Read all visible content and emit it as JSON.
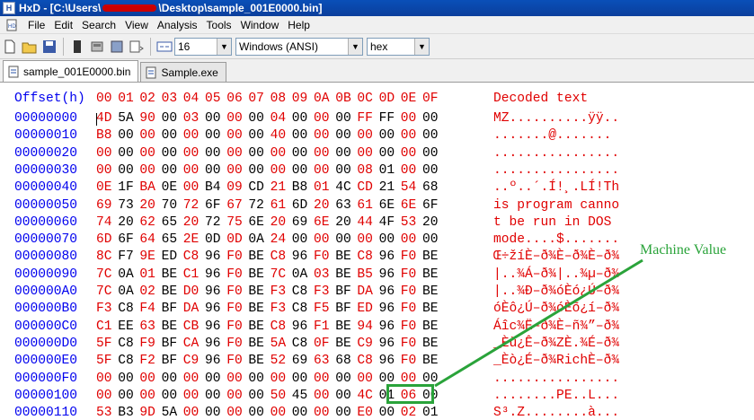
{
  "window": {
    "title_prefix": "HxD - [C:\\Users\\",
    "title_suffix": "\\Desktop\\sample_001E0000.bin]"
  },
  "menu": [
    "File",
    "Edit",
    "Search",
    "View",
    "Analysis",
    "Tools",
    "Window",
    "Help"
  ],
  "toolbar": {
    "bytes_per_row": "16",
    "charset": "Windows (ANSI)",
    "offset_base": "hex",
    "icons": [
      "new-file-icon",
      "open-file-icon",
      "save-icon",
      "ram-icon",
      "disk-icon",
      "floppy-icon",
      "export-icon",
      "columns-icon"
    ]
  },
  "tabs": [
    {
      "label": "sample_001E0000.bin",
      "active": true
    },
    {
      "label": "Sample.exe",
      "active": false
    }
  ],
  "hex": {
    "offset_header": "Offset(h)",
    "columns": [
      "00",
      "01",
      "02",
      "03",
      "04",
      "05",
      "06",
      "07",
      "08",
      "09",
      "0A",
      "0B",
      "0C",
      "0D",
      "0E",
      "0F"
    ],
    "decoded_header": "Decoded text",
    "rows": [
      {
        "offset": "00000000",
        "bytes": [
          "4D",
          "5A",
          "90",
          "00",
          "03",
          "00",
          "00",
          "00",
          "04",
          "00",
          "00",
          "00",
          "FF",
          "FF",
          "00",
          "00"
        ],
        "text": "MZ..........ÿÿ.."
      },
      {
        "offset": "00000010",
        "bytes": [
          "B8",
          "00",
          "00",
          "00",
          "00",
          "00",
          "00",
          "00",
          "40",
          "00",
          "00",
          "00",
          "00",
          "00",
          "00",
          "00"
        ],
        "text": ".......@......."
      },
      {
        "offset": "00000020",
        "bytes": [
          "00",
          "00",
          "00",
          "00",
          "00",
          "00",
          "00",
          "00",
          "00",
          "00",
          "00",
          "00",
          "00",
          "00",
          "00",
          "00"
        ],
        "text": "................"
      },
      {
        "offset": "00000030",
        "bytes": [
          "00",
          "00",
          "00",
          "00",
          "00",
          "00",
          "00",
          "00",
          "00",
          "00",
          "00",
          "00",
          "08",
          "01",
          "00",
          "00"
        ],
        "text": "................"
      },
      {
        "offset": "00000040",
        "bytes": [
          "0E",
          "1F",
          "BA",
          "0E",
          "00",
          "B4",
          "09",
          "CD",
          "21",
          "B8",
          "01",
          "4C",
          "CD",
          "21",
          "54",
          "68"
        ],
        "text": "..º..´.Í!¸.LÍ!Th"
      },
      {
        "offset": "00000050",
        "bytes": [
          "69",
          "73",
          "20",
          "70",
          "72",
          "6F",
          "67",
          "72",
          "61",
          "6D",
          "20",
          "63",
          "61",
          "6E",
          "6E",
          "6F"
        ],
        "text": "is program canno"
      },
      {
        "offset": "00000060",
        "bytes": [
          "74",
          "20",
          "62",
          "65",
          "20",
          "72",
          "75",
          "6E",
          "20",
          "69",
          "6E",
          "20",
          "44",
          "4F",
          "53",
          "20"
        ],
        "text": "t be run in DOS "
      },
      {
        "offset": "00000070",
        "bytes": [
          "6D",
          "6F",
          "64",
          "65",
          "2E",
          "0D",
          "0D",
          "0A",
          "24",
          "00",
          "00",
          "00",
          "00",
          "00",
          "00",
          "00"
        ],
        "text": "mode....$......."
      },
      {
        "offset": "00000080",
        "bytes": [
          "8C",
          "F7",
          "9E",
          "ED",
          "C8",
          "96",
          "F0",
          "BE",
          "C8",
          "96",
          "F0",
          "BE",
          "C8",
          "96",
          "F0",
          "BE"
        ],
        "text": "Œ÷žíÈ–ð¾È–ð¾È–ð¾"
      },
      {
        "offset": "00000090",
        "bytes": [
          "7C",
          "0A",
          "01",
          "BE",
          "C1",
          "96",
          "F0",
          "BE",
          "7C",
          "0A",
          "03",
          "BE",
          "B5",
          "96",
          "F0",
          "BE"
        ],
        "text": "|..¾Á–ð¾|..¾µ–ð¾"
      },
      {
        "offset": "000000A0",
        "bytes": [
          "7C",
          "0A",
          "02",
          "BE",
          "D0",
          "96",
          "F0",
          "BE",
          "F3",
          "C8",
          "F3",
          "BF",
          "DA",
          "96",
          "F0",
          "BE"
        ],
        "text": "|..¾Ð–ð¾óÈó¿Ú–ð¾"
      },
      {
        "offset": "000000B0",
        "bytes": [
          "F3",
          "C8",
          "F4",
          "BF",
          "DA",
          "96",
          "F0",
          "BE",
          "F3",
          "C8",
          "F5",
          "BF",
          "ED",
          "96",
          "F0",
          "BE"
        ],
        "text": "óÈô¿Ú–ð¾óÈõ¿í–ð¾"
      },
      {
        "offset": "000000C0",
        "bytes": [
          "C1",
          "EE",
          "63",
          "BE",
          "CB",
          "96",
          "F0",
          "BE",
          "C8",
          "96",
          "F1",
          "BE",
          "94",
          "96",
          "F0",
          "BE"
        ],
        "text": "Áîc¾Ë–ð¾È–ñ¾”–ð¾"
      },
      {
        "offset": "000000D0",
        "bytes": [
          "5F",
          "C8",
          "F9",
          "BF",
          "CA",
          "96",
          "F0",
          "BE",
          "5A",
          "C8",
          "0F",
          "BE",
          "C9",
          "96",
          "F0",
          "BE"
        ],
        "text": "_Èù¿Ê–ð¾ZÈ.¾É–ð¾"
      },
      {
        "offset": "000000E0",
        "bytes": [
          "5F",
          "C8",
          "F2",
          "BF",
          "C9",
          "96",
          "F0",
          "BE",
          "52",
          "69",
          "63",
          "68",
          "C8",
          "96",
          "F0",
          "BE"
        ],
        "text": "_Èò¿É–ð¾RichÈ–ð¾"
      },
      {
        "offset": "000000F0",
        "bytes": [
          "00",
          "00",
          "00",
          "00",
          "00",
          "00",
          "00",
          "00",
          "00",
          "00",
          "00",
          "00",
          "00",
          "00",
          "00",
          "00"
        ],
        "text": "................"
      },
      {
        "offset": "00000100",
        "bytes": [
          "00",
          "00",
          "00",
          "00",
          "00",
          "00",
          "00",
          "00",
          "50",
          "45",
          "00",
          "00",
          "4C",
          "01",
          "06",
          "00"
        ],
        "text": "........PE..L..."
      },
      {
        "offset": "00000110",
        "bytes": [
          "53",
          "B3",
          "9D",
          "5A",
          "00",
          "00",
          "00",
          "00",
          "00",
          "00",
          "00",
          "00",
          "E0",
          "00",
          "02",
          "01"
        ],
        "text": "S³.Z........à..."
      }
    ]
  },
  "annotation": {
    "label": "Machine Value",
    "color": "#2aa33a"
  }
}
